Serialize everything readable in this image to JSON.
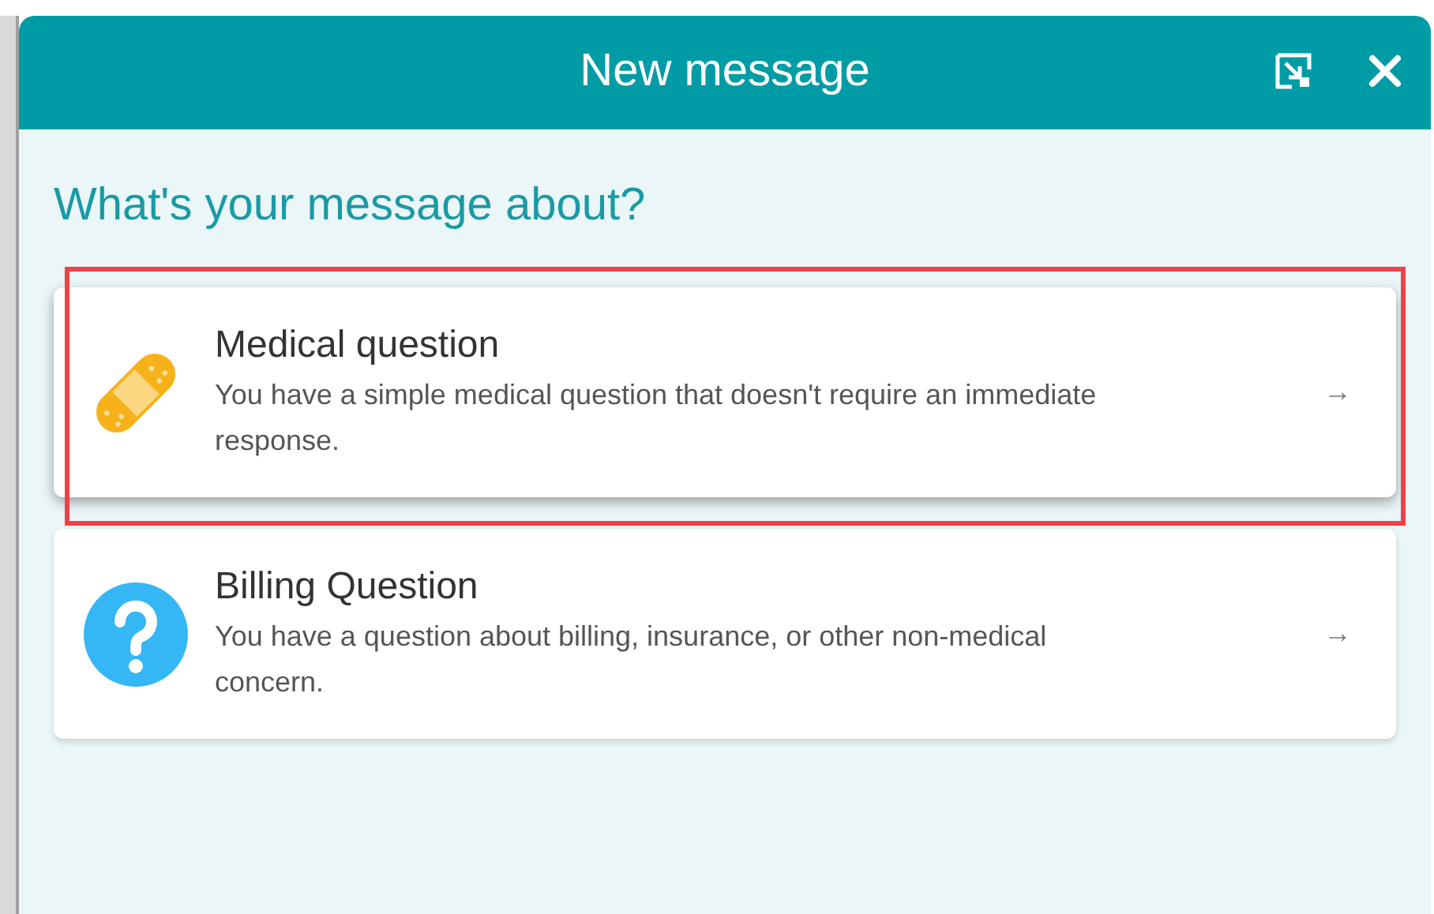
{
  "window": {
    "title": "New message"
  },
  "heading": "What's your message about?",
  "options": [
    {
      "kind": "bandage",
      "title": "Medical question",
      "description": "You have a simple medical question that doesn't require an immediate response.",
      "arrow": "→",
      "highlighted": true
    },
    {
      "kind": "question",
      "title": "Billing Question",
      "description": "You have a question about billing, insurance, or other non-medical concern.",
      "arrow": "→",
      "highlighted": false
    }
  ]
}
